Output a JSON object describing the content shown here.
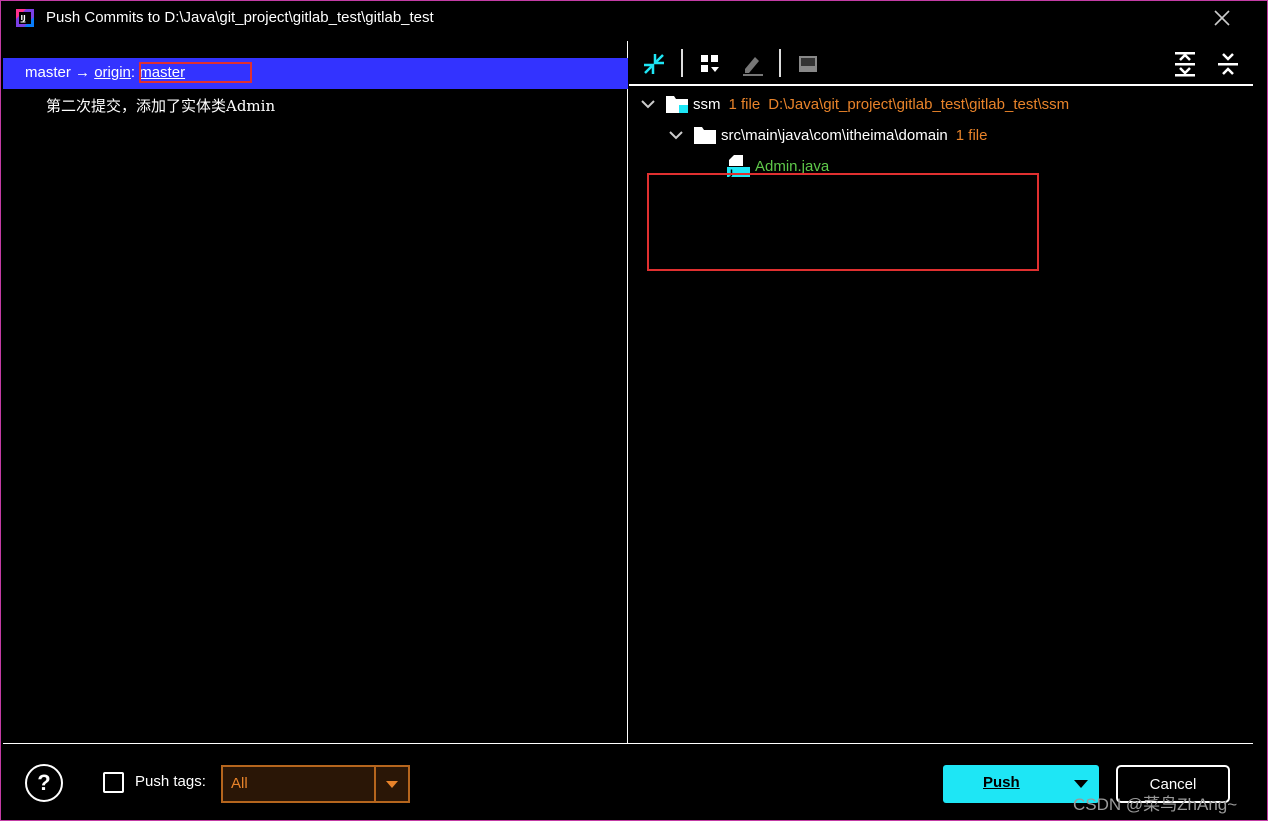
{
  "window": {
    "title": "Push Commits to D:\\Java\\git_project\\gitlab_test\\gitlab_test"
  },
  "left": {
    "branch": {
      "source": "master",
      "arrow": "→",
      "remote": "origin",
      "separator": ":",
      "target": "master"
    },
    "commit_message": "第二次提交，添加了实体类Admin"
  },
  "tree": {
    "root": {
      "name": "ssm",
      "count": "1 file",
      "path": "D:\\Java\\git_project\\gitlab_test\\gitlab_test\\ssm"
    },
    "folder": {
      "name": "src\\main\\java\\com\\itheima\\domain",
      "count": "1 file"
    },
    "file": {
      "name": "Admin.java"
    }
  },
  "bottom": {
    "help": "?",
    "push_tags_label": "Push tags:",
    "tags_select_value": "All",
    "push_label": "Push",
    "cancel_label": "Cancel",
    "watermark": "CSDN @菜鸟ZhAng~"
  },
  "colors": {
    "selection": "#3333ff",
    "accent_cyan": "#1ee6f5",
    "orange": "#e8832a",
    "green": "#5fc94a",
    "highlight_red": "#e03030"
  }
}
